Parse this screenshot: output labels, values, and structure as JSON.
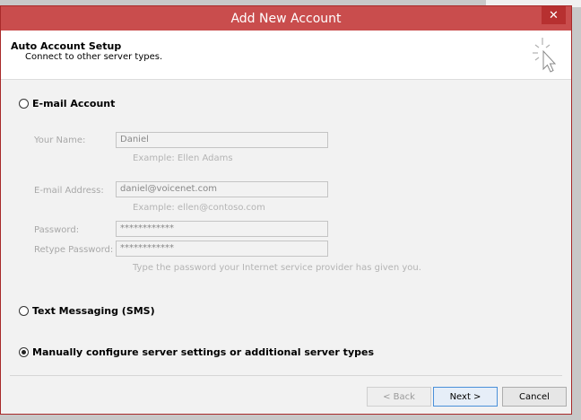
{
  "window": {
    "title": "Add New Account",
    "close_glyph": "✕"
  },
  "header": {
    "title": "Auto Account Setup",
    "subtitle": "Connect to other server types.",
    "icon": "sparkle-cursor-icon"
  },
  "email_account": {
    "label": "E-mail Account",
    "selected": false,
    "fields": {
      "your_name": {
        "label": "Your Name:",
        "value": "Daniel",
        "hint": "Example: Ellen Adams"
      },
      "email": {
        "label": "E-mail Address:",
        "value": "daniel@voicenet.com",
        "hint": "Example: ellen@contoso.com"
      },
      "password": {
        "label": "Password:",
        "value": "************"
      },
      "retype_password": {
        "label": "Retype Password:",
        "value": "************",
        "hint": "Type the password your Internet service provider has given you."
      }
    }
  },
  "sms": {
    "label": "Text Messaging (SMS)",
    "selected": false
  },
  "manual": {
    "label": "Manually configure server settings or additional server types",
    "selected": true
  },
  "buttons": {
    "back": "< Back",
    "next": "Next >",
    "cancel": "Cancel"
  },
  "colors": {
    "titlebar": "#c94d4d",
    "close": "#b73030"
  }
}
